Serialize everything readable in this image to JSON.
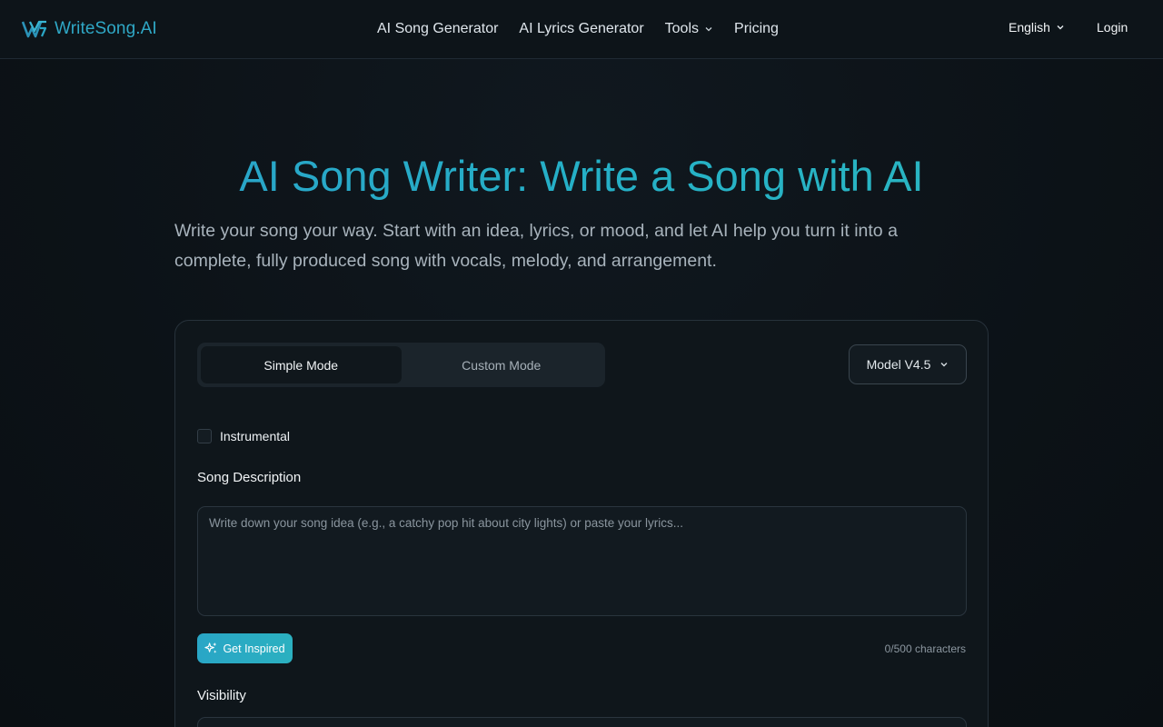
{
  "header": {
    "brand": "WriteSong.AI",
    "nav": [
      {
        "label": "AI Song Generator",
        "has_dropdown": false
      },
      {
        "label": "AI Lyrics Generator",
        "has_dropdown": false
      },
      {
        "label": "Tools",
        "has_dropdown": true
      },
      {
        "label": "Pricing",
        "has_dropdown": false
      }
    ],
    "language": "English",
    "login": "Login"
  },
  "hero": {
    "title": "AI Song Writer: Write a Song with AI",
    "subtitle": "Write your song your way. Start with an idea, lyrics, or mood, and let AI help you turn it into a complete, fully produced song with vocals, melody, and arrangement."
  },
  "form": {
    "modes": [
      "Simple Mode",
      "Custom Mode"
    ],
    "active_mode": "Simple Mode",
    "model": "Model V4.5",
    "instrumental_label": "Instrumental",
    "instrumental_checked": false,
    "description_label": "Song Description",
    "description_placeholder": "Write down your song idea (e.g., a catchy pop hit about city lights) or paste your lyrics...",
    "description_value": "",
    "inspire_label": "Get Inspired",
    "char_count": "0/500 characters",
    "visibility_label": "Visibility"
  },
  "colors": {
    "accent": "#2aa9c4",
    "background": "#0c1217",
    "card": "#0f161b"
  }
}
